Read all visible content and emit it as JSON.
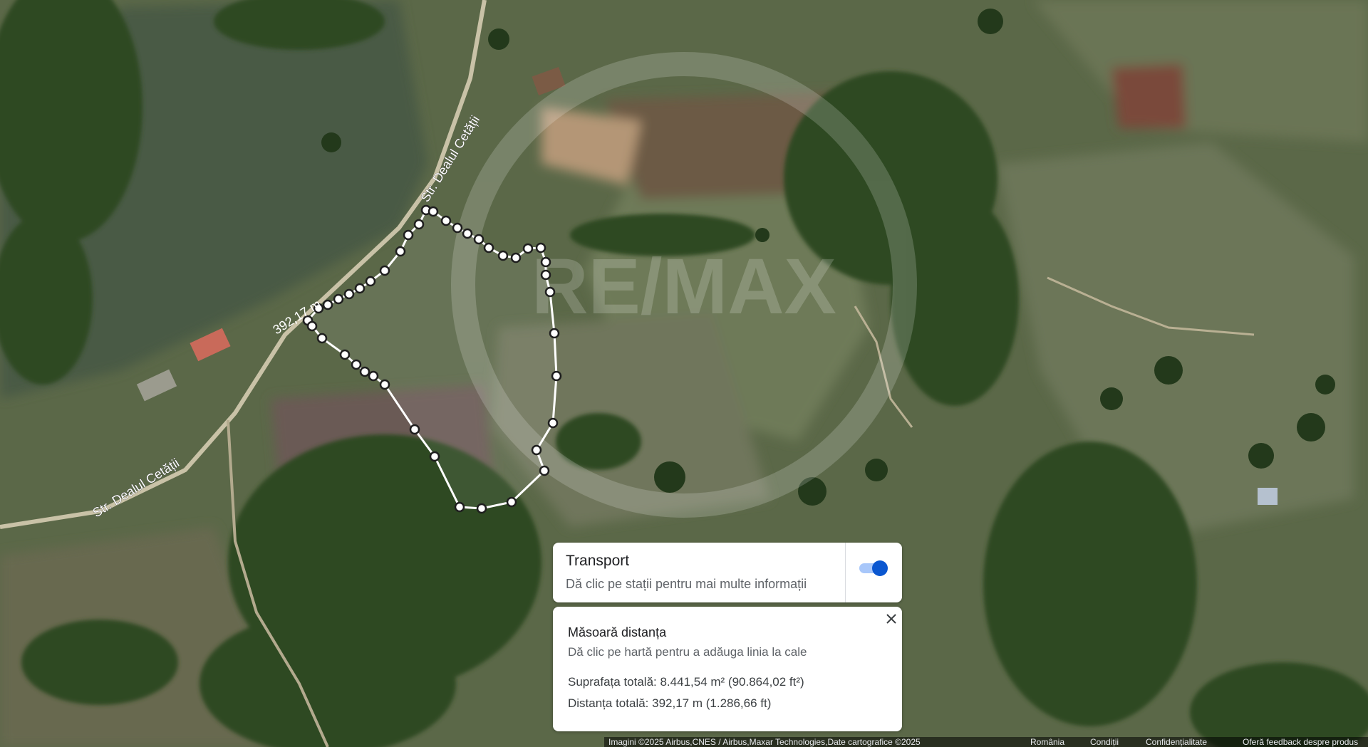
{
  "map": {
    "roads": [
      "Str. Dealul Cetății",
      "Str. Dealul Cetății"
    ],
    "segment_label": "392,17 m",
    "watermark": "RE/MAX"
  },
  "transport": {
    "title": "Transport",
    "subtitle": "Dă clic pe stații pentru mai multe informații",
    "toggle_on": true
  },
  "measure": {
    "title": "Măsoară distanța",
    "subtitle": "Dă clic pe hartă pentru a adăuga linia la cale",
    "area": "Suprafața totală: 8.441,54 m² (90.864,02 ft²)",
    "distance": "Distanța totală: 392,17 m (1.286,66 ft)"
  },
  "footer": {
    "attribution": "Imagini ©2025 Airbus,CNES / Airbus,Maxar Technologies,Date cartografice ©2025",
    "country": "România",
    "terms": "Condiții",
    "privacy": "Confidențialitate",
    "feedback": "Oferă feedback despre produs"
  },
  "colors": {
    "accent": "#0b57d0",
    "toggle_track": "#a8c7fa"
  }
}
